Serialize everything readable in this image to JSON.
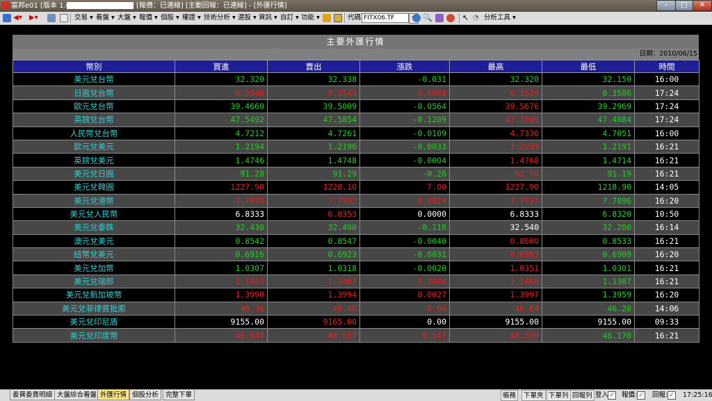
{
  "window": {
    "title": "富邦e01 [版本 1.65",
    "title_suffix": "[報價：已連線] [主動回報：已連線] - [外匯行情]",
    "minimize": "–",
    "maximize": "□",
    "close": "✕"
  },
  "toolbar": {
    "menus": [
      "交易 ▾",
      "看盤 ▾",
      "大盤 ▾",
      "報價 ▾",
      "個股 ▾",
      "權證 ▾",
      "技術分析 ▾",
      "選股 ▾",
      "資訊 ▾",
      "自訂 ▾",
      "功能 ▾"
    ],
    "code_label": "代碼",
    "code_value": "FITX06.TF",
    "analysis_tools": "分析工具 ▾"
  },
  "panel": {
    "title": "主要外匯行情",
    "date": "日期：2010/06/15"
  },
  "table": {
    "headers": [
      "幣別",
      "買進",
      "賣出",
      "漲跌",
      "最高",
      "最低",
      "時間"
    ],
    "rows": [
      {
        "name": "美元兌台幣",
        "bid": "32.320",
        "ask": "32.338",
        "chg": "-0.031",
        "high": "32.320",
        "low": "32.150",
        "time": "16:00",
        "c": [
          "g",
          "g",
          "g",
          "g",
          "g"
        ]
      },
      {
        "name": "日圓兌台幣",
        "bid": "0.3540",
        "ask": "0.3543",
        "chg": "0.0008",
        "high": "0.3539",
        "low": "0.3506",
        "time": "17:24",
        "c": [
          "r",
          "r",
          "r",
          "r",
          "g"
        ]
      },
      {
        "name": "歐元兌台幣",
        "bid": "39.4660",
        "ask": "39.5009",
        "chg": "-0.0564",
        "high": "39.5676",
        "low": "39.2969",
        "time": "17:24",
        "c": [
          "g",
          "g",
          "g",
          "r",
          "g"
        ]
      },
      {
        "name": "英鎊兌台幣",
        "bid": "47.5492",
        "ask": "47.5854",
        "chg": "-0.1209",
        "high": "47.7509",
        "low": "47.4084",
        "time": "17:24",
        "c": [
          "g",
          "g",
          "g",
          "r",
          "g"
        ]
      },
      {
        "name": "人民幣兌台幣",
        "bid": "4.7212",
        "ask": "4.7261",
        "chg": "-0.0109",
        "high": "4.7336",
        "low": "4.7051",
        "time": "16:00",
        "c": [
          "g",
          "g",
          "g",
          "r",
          "g"
        ]
      },
      {
        "name": "歐元兌美元",
        "bid": "1.2194",
        "ask": "1.2196",
        "chg": "-0.0033",
        "high": "1.2233",
        "low": "1.2191",
        "time": "16:21",
        "c": [
          "g",
          "g",
          "g",
          "r",
          "g"
        ]
      },
      {
        "name": "英鎊兌美元",
        "bid": "1.4746",
        "ask": "1.4748",
        "chg": "-0.0004",
        "high": "1.4768",
        "low": "1.4714",
        "time": "16:21",
        "c": [
          "g",
          "g",
          "g",
          "r",
          "g"
        ]
      },
      {
        "name": "美元兌日圓",
        "bid": "91.28",
        "ask": "91.29",
        "chg": "-0.26",
        "high": "91.70",
        "low": "91.19",
        "time": "16:21",
        "c": [
          "g",
          "g",
          "g",
          "r",
          "g"
        ]
      },
      {
        "name": "美元兌韓圓",
        "bid": "1227.90",
        "ask": "1228.10",
        "chg": "7.00",
        "high": "1227.90",
        "low": "1218.90",
        "time": "14:05",
        "c": [
          "r",
          "r",
          "r",
          "r",
          "g"
        ]
      },
      {
        "name": "美元兌港幣",
        "bid": "7.7928",
        "ask": "7.7932",
        "chg": "0.0024",
        "high": "7.7937",
        "low": "7.7896",
        "time": "16:20",
        "c": [
          "r",
          "r",
          "r",
          "r",
          "g"
        ]
      },
      {
        "name": "美元兌人民幣",
        "bid": "6.8333",
        "ask": "6.8353",
        "chg": "0.0000",
        "high": "6.8333",
        "low": "6.8320",
        "time": "10:50",
        "c": [
          "w",
          "r",
          "w",
          "w",
          "g"
        ]
      },
      {
        "name": "美元兌泰銖",
        "bid": "32.430",
        "ask": "32.490",
        "chg": "-0.110",
        "high": "32.540",
        "low": "32.280",
        "time": "16:14",
        "c": [
          "g",
          "g",
          "g",
          "w",
          "g"
        ]
      },
      {
        "name": "澳元兌美元",
        "bid": "0.8542",
        "ask": "0.8547",
        "chg": "-0.0040",
        "high": "0.8600",
        "low": "0.8533",
        "time": "16:21",
        "c": [
          "g",
          "g",
          "g",
          "r",
          "g"
        ]
      },
      {
        "name": "紐幣兌美元",
        "bid": "0.6916",
        "ask": "0.6923",
        "chg": "-0.0031",
        "high": "0.6965",
        "low": "0.6909",
        "time": "16:20",
        "c": [
          "g",
          "g",
          "g",
          "r",
          "g"
        ]
      },
      {
        "name": "美元兌加幣",
        "bid": "1.0307",
        "ask": "1.0318",
        "chg": "-0.0020",
        "high": "1.0351",
        "low": "1.0301",
        "time": "16:21",
        "c": [
          "g",
          "g",
          "g",
          "r",
          "g"
        ]
      },
      {
        "name": "美元兌瑞郎",
        "bid": "1.1463",
        "ask": "1.1467",
        "chg": "0.0044",
        "high": "1.1466",
        "low": "1.1387",
        "time": "16:21",
        "c": [
          "r",
          "r",
          "r",
          "r",
          "g"
        ]
      },
      {
        "name": "美元兌新加坡幣",
        "bid": "1.3990",
        "ask": "1.3994",
        "chg": "0.0027",
        "high": "1.3997",
        "low": "1.3959",
        "time": "16:20",
        "c": [
          "r",
          "r",
          "r",
          "r",
          "g"
        ]
      },
      {
        "name": "美元兌菲律賓批索",
        "bid": "46.36",
        "ask": "46.46",
        "chg": "0.04",
        "high": "46.64",
        "low": "46.20",
        "time": "14:06",
        "c": [
          "r",
          "r",
          "r",
          "r",
          "g"
        ]
      },
      {
        "name": "美元兌印尼盾",
        "bid": "9155.00",
        "ask": "9165.00",
        "chg": "0.00",
        "high": "9155.00",
        "low": "9155.00",
        "time": "09:33",
        "c": [
          "w",
          "r",
          "w",
          "w",
          "w"
        ]
      },
      {
        "name": "美元兌印度幣",
        "bid": "46.647",
        "ask": "46.657",
        "chg": "0.147",
        "high": "46.690",
        "low": "46.170",
        "time": "16:21",
        "c": [
          "r",
          "r",
          "r",
          "r",
          "g"
        ]
      }
    ]
  },
  "bottombar": {
    "tabs": [
      "委買委賣明細",
      "大盤綜合看盤",
      "外匯行情",
      "個股分析",
      "完整下單"
    ],
    "buttons": [
      "帳務",
      "下單夾",
      "下單列",
      "回報列"
    ],
    "login_label": "登入:",
    "quote_label": "報價:",
    "report_label": "回報:",
    "check": "✓",
    "clock": "17:25:16"
  },
  "colors": {
    "up": "#ee1c1c",
    "down": "#1fd01f",
    "flat": "#ffffff",
    "name": "#2fd0d4",
    "header": "#1e1e96"
  }
}
